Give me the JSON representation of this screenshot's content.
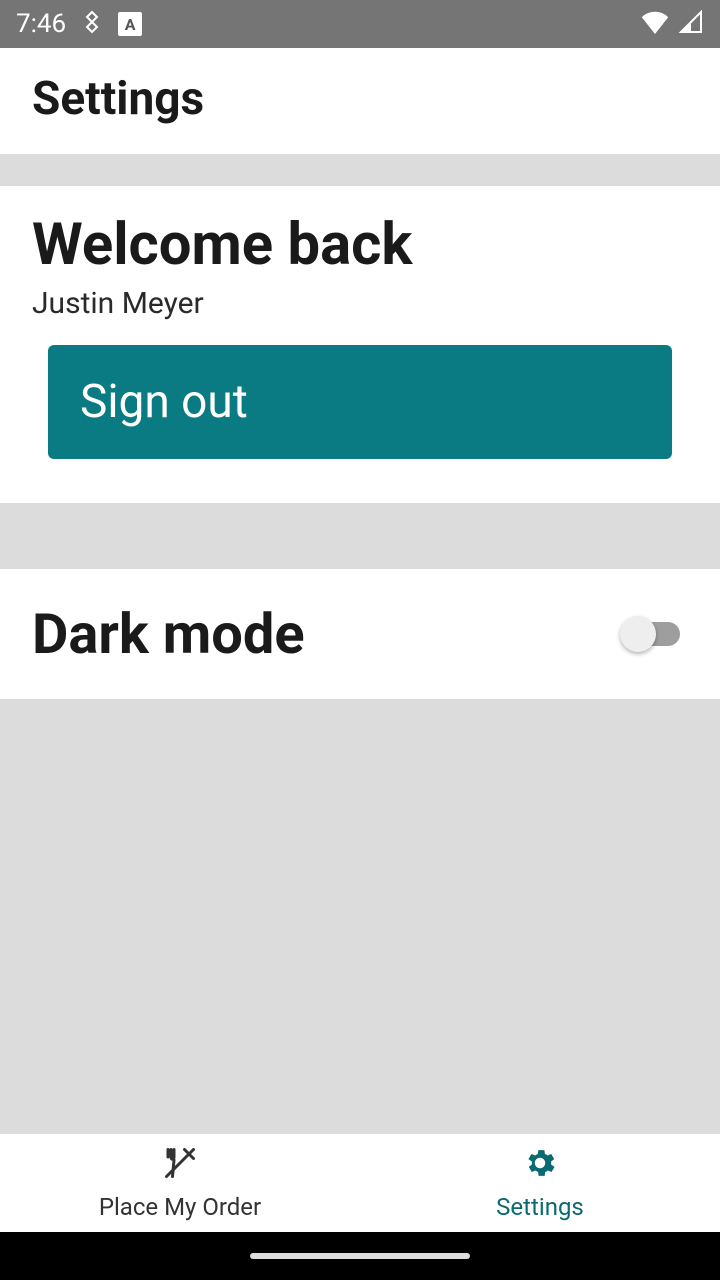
{
  "status_bar": {
    "time": "7:46"
  },
  "header": {
    "title": "Settings"
  },
  "welcome": {
    "title": "Welcome back",
    "user_name": "Justin Meyer",
    "sign_out_label": "Sign out"
  },
  "dark_mode": {
    "label": "Dark mode",
    "enabled": false
  },
  "bottom_nav": {
    "place_order_label": "Place My Order",
    "settings_label": "Settings",
    "active": "settings"
  },
  "colors": {
    "accent": "#0a7b82",
    "accent_dark": "#0a6a72"
  }
}
